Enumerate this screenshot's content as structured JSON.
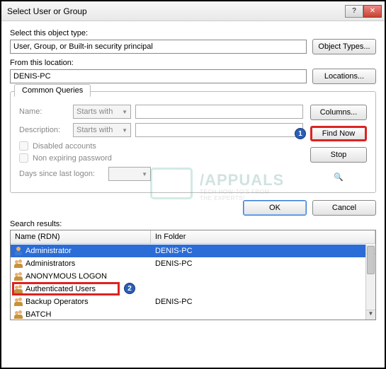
{
  "window": {
    "title": "Select User or Group"
  },
  "labels": {
    "object_type": "Select this object type:",
    "from_location": "From this location:",
    "common_queries": "Common Queries",
    "name": "Name:",
    "description": "Description:",
    "disabled_accounts": "Disabled accounts",
    "non_expiring": "Non expiring password",
    "days_since": "Days since last logon:",
    "search_results": "Search results:",
    "col_name": "Name (RDN)",
    "col_folder": "In Folder"
  },
  "fields": {
    "object_type_value": "User, Group, or Built-in security principal",
    "location_value": "DENIS-PC",
    "name_mode": "Starts with",
    "desc_mode": "Starts with"
  },
  "buttons": {
    "object_types": "Object Types...",
    "locations": "Locations...",
    "columns": "Columns...",
    "find_now": "Find Now",
    "stop": "Stop",
    "ok": "OK",
    "cancel": "Cancel"
  },
  "annotations": {
    "badge1": "1",
    "badge2": "2"
  },
  "results": [
    {
      "icon": "user",
      "name": "Administrator",
      "folder": "DENIS-PC",
      "selected": true
    },
    {
      "icon": "group",
      "name": "Administrators",
      "folder": "DENIS-PC",
      "selected": false
    },
    {
      "icon": "group",
      "name": "ANONYMOUS LOGON",
      "folder": "",
      "selected": false
    },
    {
      "icon": "group",
      "name": "Authenticated Users",
      "folder": "",
      "selected": false,
      "highlighted": true
    },
    {
      "icon": "group",
      "name": "Backup Operators",
      "folder": "DENIS-PC",
      "selected": false
    },
    {
      "icon": "group",
      "name": "BATCH",
      "folder": "",
      "selected": false
    }
  ]
}
